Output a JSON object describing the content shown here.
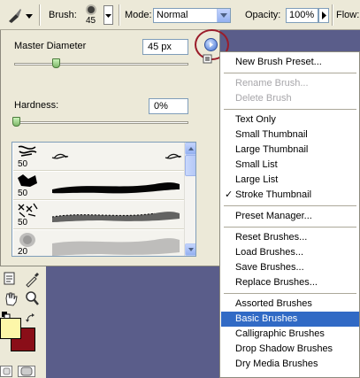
{
  "options_bar": {
    "brush_label": "Brush:",
    "brush_size": "45",
    "mode_label": "Mode:",
    "mode_value": "Normal",
    "opacity_label": "Opacity:",
    "opacity_value": "100%",
    "flow_label": "Flow:"
  },
  "panel": {
    "master_diameter_label": "Master Diameter",
    "master_diameter_value": "45 px",
    "master_diameter_level": 0.24,
    "hardness_label": "Hardness:",
    "hardness_value": "0%",
    "hardness_level": 0.0,
    "brushes": [
      {
        "size": "50",
        "stroke": "sketch"
      },
      {
        "size": "50",
        "stroke": "solid"
      },
      {
        "size": "50",
        "stroke": "scatter"
      },
      {
        "size": "20",
        "stroke": "soft"
      }
    ]
  },
  "menu": {
    "items": [
      {
        "label": "New Brush Preset...",
        "state": "normal"
      },
      {
        "sep": true
      },
      {
        "label": "Rename Brush...",
        "state": "disabled"
      },
      {
        "label": "Delete Brush",
        "state": "disabled"
      },
      {
        "sep": true
      },
      {
        "label": "Text Only",
        "state": "normal"
      },
      {
        "label": "Small Thumbnail",
        "state": "normal"
      },
      {
        "label": "Large Thumbnail",
        "state": "normal"
      },
      {
        "label": "Small List",
        "state": "normal"
      },
      {
        "label": "Large List",
        "state": "normal"
      },
      {
        "label": "Stroke Thumbnail",
        "state": "checked"
      },
      {
        "sep": true
      },
      {
        "label": "Preset Manager...",
        "state": "normal"
      },
      {
        "sep": true
      },
      {
        "label": "Reset Brushes...",
        "state": "normal"
      },
      {
        "label": "Load Brushes...",
        "state": "normal"
      },
      {
        "label": "Save Brushes...",
        "state": "normal"
      },
      {
        "label": "Replace Brushes...",
        "state": "normal"
      },
      {
        "sep": true
      },
      {
        "label": "Assorted Brushes",
        "state": "normal"
      },
      {
        "label": "Basic Brushes",
        "state": "highlighted"
      },
      {
        "label": "Calligraphic Brushes",
        "state": "normal"
      },
      {
        "label": "Drop Shadow Brushes",
        "state": "normal"
      },
      {
        "label": "Dry Media Brushes",
        "state": "normal"
      }
    ]
  },
  "colors": {
    "foreground": "#fdf7a9",
    "background": "#8a0e18",
    "highlight": "#316ac5",
    "callout_circle": "#9b1c2a"
  }
}
